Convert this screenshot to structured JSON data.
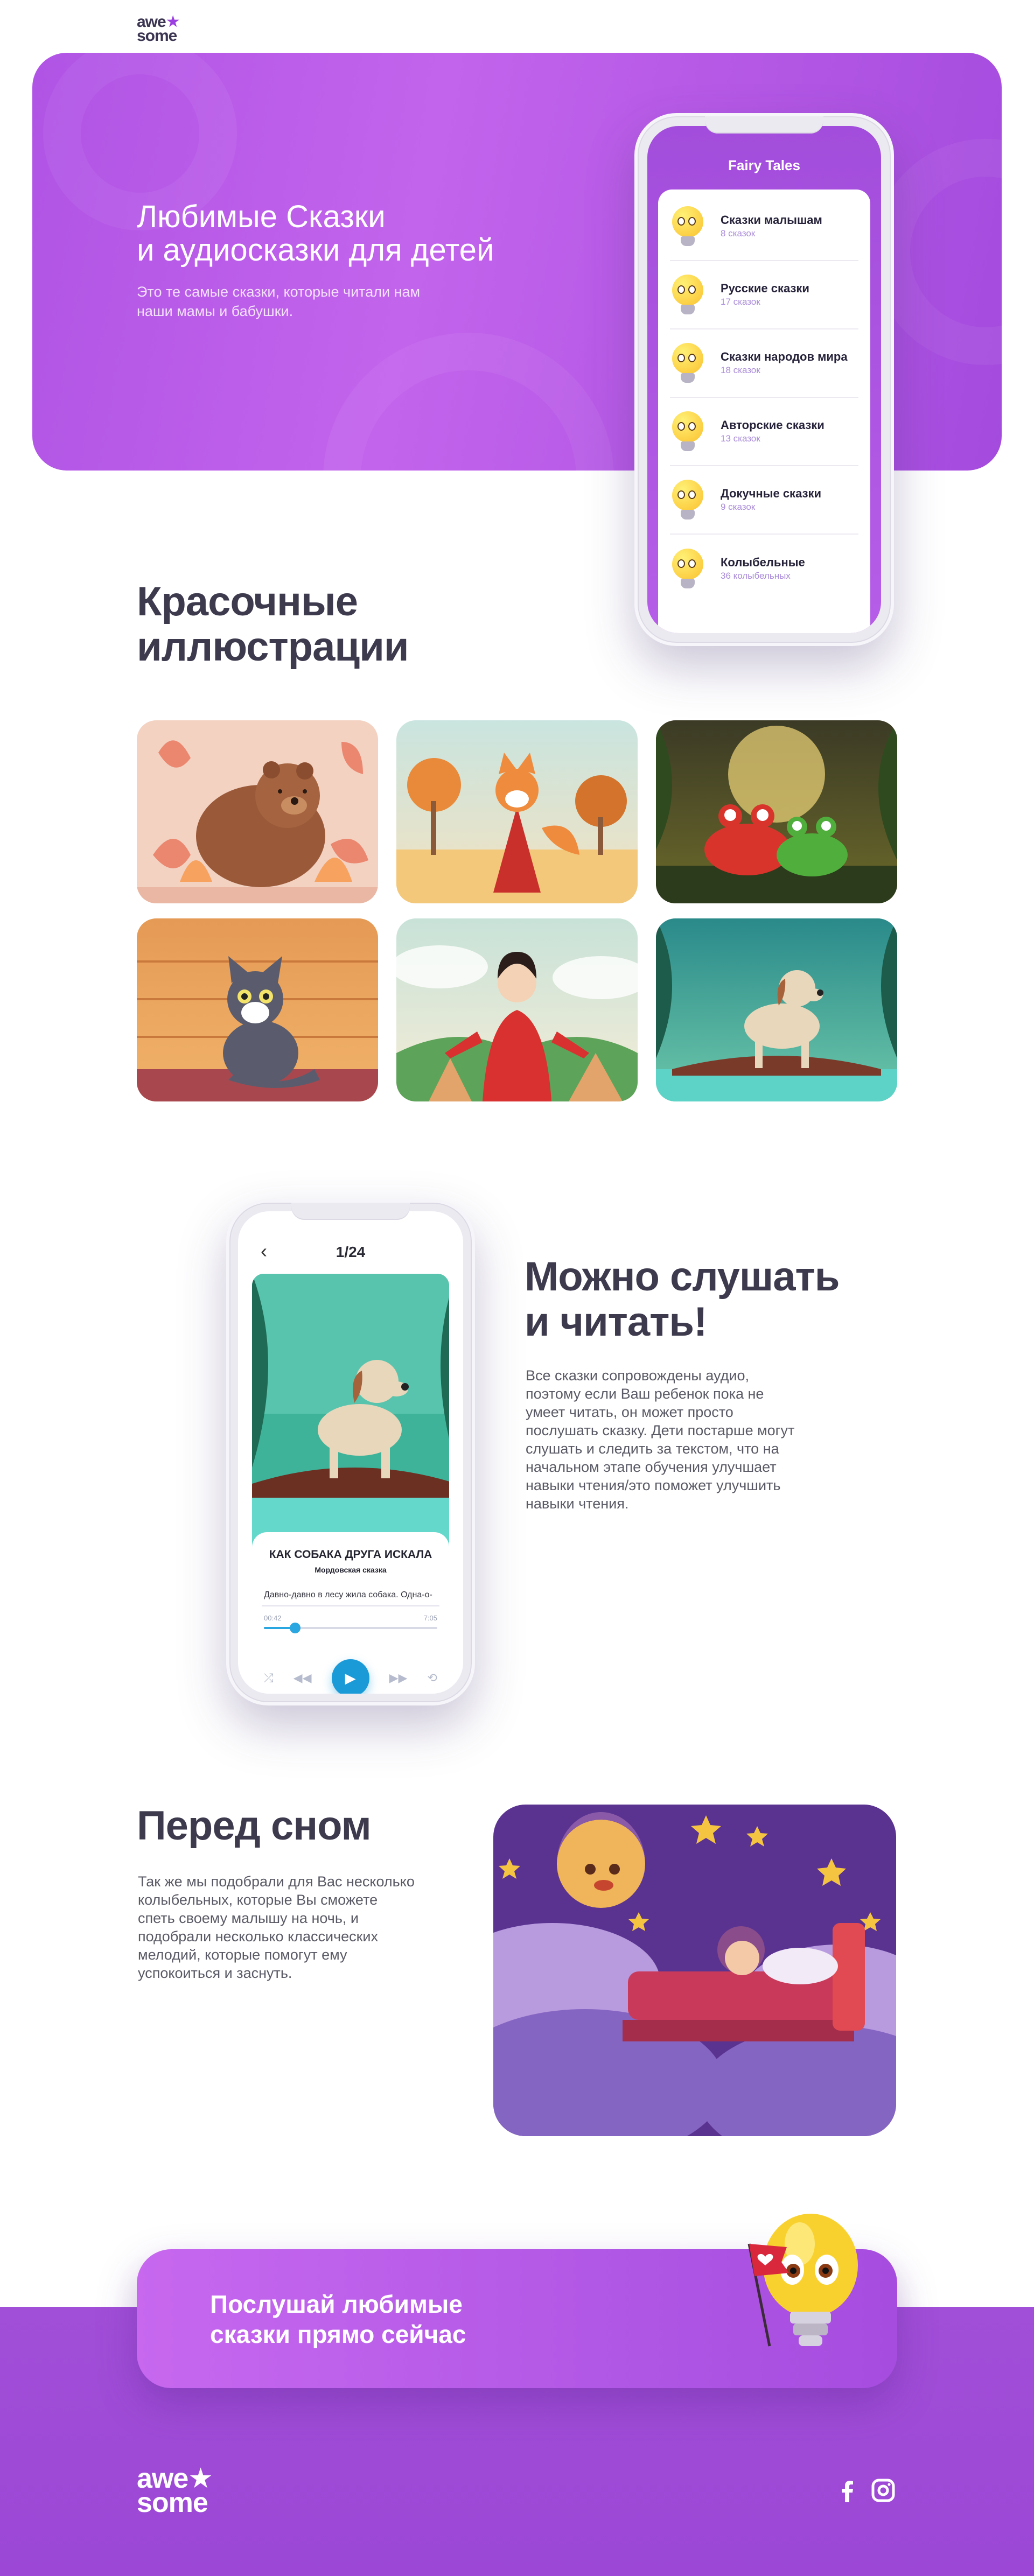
{
  "logo": {
    "line1": "awe",
    "star": "★",
    "line2": "some"
  },
  "hero": {
    "title_line1": "Любимые Сказки",
    "title_line2": "и аудиосказки для детей",
    "subtitle": "Это те самые сказки, которые читали нам наши мамы и бабушки."
  },
  "app_list": {
    "header": "Fairy Tales",
    "items": [
      {
        "name": "Сказки малышам",
        "count": "8 сказок"
      },
      {
        "name": "Русские сказки",
        "count": "17 сказок"
      },
      {
        "name": "Сказки народов мира",
        "count": "18 сказок"
      },
      {
        "name": "Авторские сказки",
        "count": "13 сказок"
      },
      {
        "name": "Докучные сказки",
        "count": "9 сказок"
      },
      {
        "name": "Колыбельные",
        "count": "36 колыбельных"
      }
    ]
  },
  "illustrations": {
    "title_line1": "Красочные",
    "title_line2": "иллюстрации",
    "tiles": [
      "bear",
      "fox",
      "frogs",
      "cat",
      "girl",
      "dog"
    ]
  },
  "reader": {
    "page": "1/24",
    "story_title": "КАК СОБАКА ДРУГА ИСКАЛА",
    "story_origin": "Мордовская сказка",
    "story_text": "Давно-давно в лесу жила собака. Одна-о-",
    "time_elapsed": "00:42",
    "time_total": "7:05",
    "progress": 0.18
  },
  "listen": {
    "title_line1": "Можно слушать",
    "title_line2": "и читать!",
    "text": "Все сказки сопровождены аудио, поэтому если Ваш ребенок пока не умеет читать, он может просто послушать сказку. Дети постарше могут слушать и следить за текстом, что на начальном этапе обучения улучшает навыки чтения/это поможет улучшить навыки чтения."
  },
  "bedtime": {
    "title": "Перед сном",
    "text": "Так же мы подобрали для Вас несколько колыбельных, которые Вы сможете спеть своему малышу на ночь, и подобрали несколько классических мелодий, которые помогут ему успокоиться и заснуть."
  },
  "cta": {
    "line1": "Послушай любимые",
    "line2": "сказки прямо сейчас"
  },
  "footer": {
    "socials": [
      "facebook-icon",
      "instagram-icon"
    ]
  },
  "colors": {
    "purple": "#a64cdf",
    "accent_blue": "#1b9ad8",
    "heading": "#3d3a4e"
  }
}
